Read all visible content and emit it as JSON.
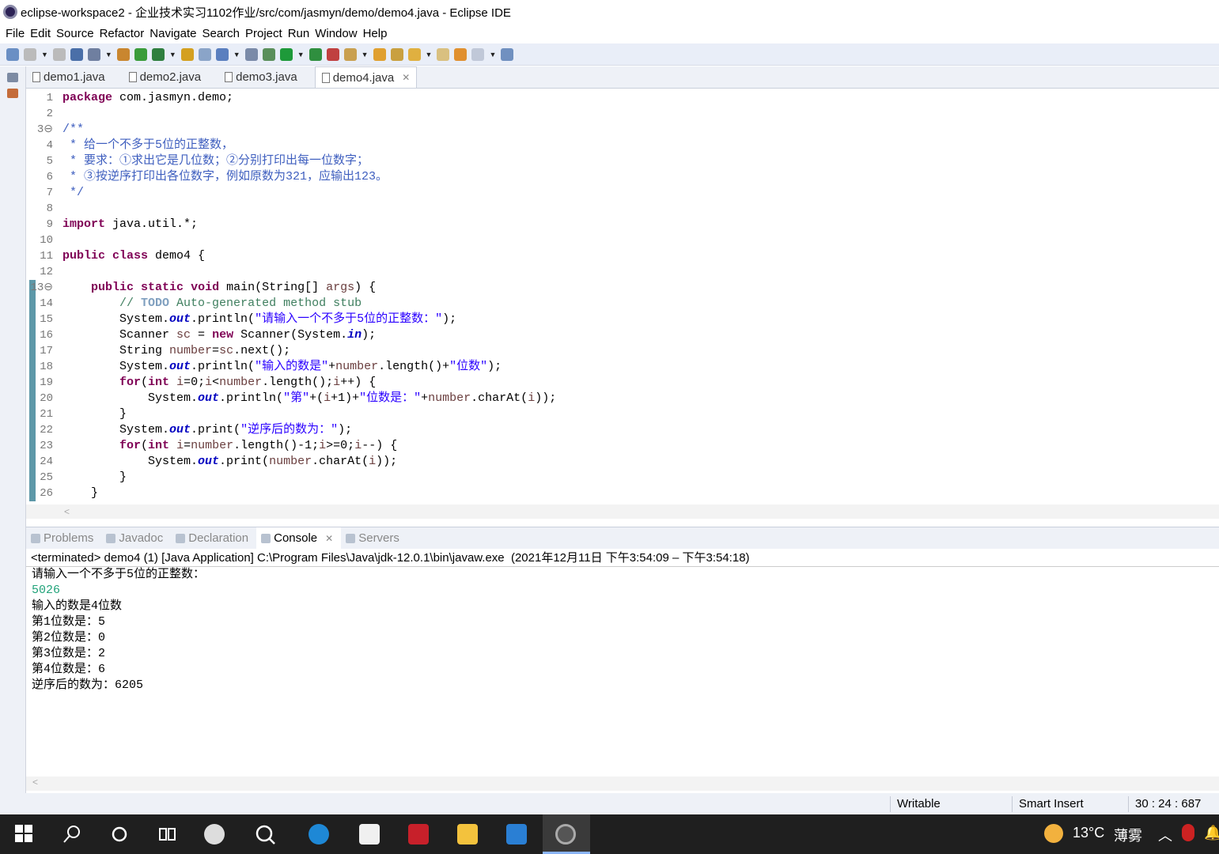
{
  "window": {
    "title": "eclipse-workspace2 - 企业技术实习1102作业/src/com/jasmyn/demo/demo4.java - Eclipse IDE"
  },
  "menu": [
    "File",
    "Edit",
    "Source",
    "Refactor",
    "Navigate",
    "Search",
    "Project",
    "Run",
    "Window",
    "Help"
  ],
  "editor_tabs": [
    {
      "label": "demo1.java"
    },
    {
      "label": "demo2.java"
    },
    {
      "label": "demo3.java"
    },
    {
      "label": "demo4.java",
      "active": true,
      "close": "✕"
    }
  ],
  "code": [
    [
      [
        "kw",
        "package"
      ],
      [
        "pl",
        " com.jasmyn.demo;"
      ]
    ],
    [],
    [
      [
        "jd",
        "/**"
      ]
    ],
    [
      [
        "jd",
        " * 给一个不多于5位的正整数，"
      ]
    ],
    [
      [
        "jd",
        " * 要求：①求出它是几位数；②分别打印出每一位数字；"
      ]
    ],
    [
      [
        "jd",
        " * ③按逆序打印出各位数字，例如原数为321，应输出123。"
      ]
    ],
    [
      [
        "jd",
        " */"
      ]
    ],
    [],
    [
      [
        "kw",
        "import"
      ],
      [
        "pl",
        " java.util.*;"
      ]
    ],
    [],
    [
      [
        "kw",
        "public"
      ],
      [
        "pl",
        " "
      ],
      [
        "kw",
        "class"
      ],
      [
        "pl",
        " demo4 {"
      ]
    ],
    [],
    [
      [
        "pl",
        "    "
      ],
      [
        "kw",
        "public"
      ],
      [
        "pl",
        " "
      ],
      [
        "kw",
        "static"
      ],
      [
        "pl",
        " "
      ],
      [
        "kw",
        "void"
      ],
      [
        "pl",
        " main(String[] "
      ],
      [
        "var",
        "args"
      ],
      [
        "pl",
        ") {"
      ]
    ],
    [
      [
        "pl",
        "        "
      ],
      [
        "com",
        "// "
      ],
      [
        "todo",
        "TODO"
      ],
      [
        "com",
        " Auto-generated method stub"
      ]
    ],
    [
      [
        "pl",
        "        System."
      ],
      [
        "fld",
        "out"
      ],
      [
        "pl",
        ".println("
      ],
      [
        "str",
        "\"请输入一个不多于5位的正整数：\""
      ],
      [
        "pl",
        ");"
      ]
    ],
    [
      [
        "pl",
        "        Scanner "
      ],
      [
        "var",
        "sc"
      ],
      [
        "pl",
        " = "
      ],
      [
        "kw",
        "new"
      ],
      [
        "pl",
        " Scanner(System."
      ],
      [
        "fld",
        "in"
      ],
      [
        "pl",
        ");"
      ]
    ],
    [
      [
        "pl",
        "        String "
      ],
      [
        "var",
        "number"
      ],
      [
        "pl",
        "="
      ],
      [
        "var",
        "sc"
      ],
      [
        "pl",
        ".next();"
      ]
    ],
    [
      [
        "pl",
        "        System."
      ],
      [
        "fld",
        "out"
      ],
      [
        "pl",
        ".println("
      ],
      [
        "str",
        "\"输入的数是\""
      ],
      [
        "pl",
        "+"
      ],
      [
        "var",
        "number"
      ],
      [
        "pl",
        ".length()+"
      ],
      [
        "str",
        "\"位数\""
      ],
      [
        "pl",
        ");"
      ]
    ],
    [
      [
        "pl",
        "        "
      ],
      [
        "kw",
        "for"
      ],
      [
        "pl",
        "("
      ],
      [
        "kw",
        "int"
      ],
      [
        "pl",
        " "
      ],
      [
        "var",
        "i"
      ],
      [
        "pl",
        "=0;"
      ],
      [
        "var",
        "i"
      ],
      [
        "pl",
        "<"
      ],
      [
        "var",
        "number"
      ],
      [
        "pl",
        ".length();"
      ],
      [
        "var",
        "i"
      ],
      [
        "pl",
        "++) {"
      ]
    ],
    [
      [
        "pl",
        "            System."
      ],
      [
        "fld",
        "out"
      ],
      [
        "pl",
        ".println("
      ],
      [
        "str",
        "\"第\""
      ],
      [
        "pl",
        "+("
      ],
      [
        "var",
        "i"
      ],
      [
        "pl",
        "+1)+"
      ],
      [
        "str",
        "\"位数是：\""
      ],
      [
        "pl",
        "+"
      ],
      [
        "var",
        "number"
      ],
      [
        "pl",
        ".charAt("
      ],
      [
        "var",
        "i"
      ],
      [
        "pl",
        "));"
      ]
    ],
    [
      [
        "pl",
        "        }"
      ]
    ],
    [
      [
        "pl",
        "        System."
      ],
      [
        "fld",
        "out"
      ],
      [
        "pl",
        ".print("
      ],
      [
        "str",
        "\"逆序后的数为：\""
      ],
      [
        "pl",
        ");"
      ]
    ],
    [
      [
        "pl",
        "        "
      ],
      [
        "kw",
        "for"
      ],
      [
        "pl",
        "("
      ],
      [
        "kw",
        "int"
      ],
      [
        "pl",
        " "
      ],
      [
        "var",
        "i"
      ],
      [
        "pl",
        "="
      ],
      [
        "var",
        "number"
      ],
      [
        "pl",
        ".length()-1;"
      ],
      [
        "var",
        "i"
      ],
      [
        "pl",
        ">=0;"
      ],
      [
        "var",
        "i"
      ],
      [
        "pl",
        "--) {"
      ]
    ],
    [
      [
        "pl",
        "            System."
      ],
      [
        "fld",
        "out"
      ],
      [
        "pl",
        ".print("
      ],
      [
        "var",
        "number"
      ],
      [
        "pl",
        ".charAt("
      ],
      [
        "var",
        "i"
      ],
      [
        "pl",
        "));"
      ]
    ],
    [
      [
        "pl",
        "        }"
      ]
    ],
    [
      [
        "pl",
        "    }"
      ]
    ]
  ],
  "bottom_tabs": [
    {
      "label": "Problems"
    },
    {
      "label": "Javadoc"
    },
    {
      "label": "Declaration"
    },
    {
      "label": "Console",
      "active": true,
      "close": "✕"
    },
    {
      "label": "Servers"
    }
  ],
  "console": {
    "header": "<terminated> demo4 (1) [Java Application] C:\\Program Files\\Java\\jdk-12.0.1\\bin\\javaw.exe  (2021年12月11日 下午3:54:09 – 下午3:54:18)",
    "lines": [
      {
        "text": "请输入一个不多于5位的正整数："
      },
      {
        "text": "5026",
        "input": true
      },
      {
        "text": "输入的数是4位数"
      },
      {
        "text": "第1位数是：5"
      },
      {
        "text": "第2位数是：0"
      },
      {
        "text": "第3位数是：2"
      },
      {
        "text": "第4位数是：6"
      },
      {
        "text": "逆序后的数为：6205"
      }
    ]
  },
  "status": {
    "writable": "Writable",
    "insert_mode": "Smart Insert",
    "position": "30 : 24 : 687"
  },
  "taskbar": {
    "weather": "13°C",
    "weather_desc": "薄雾"
  }
}
